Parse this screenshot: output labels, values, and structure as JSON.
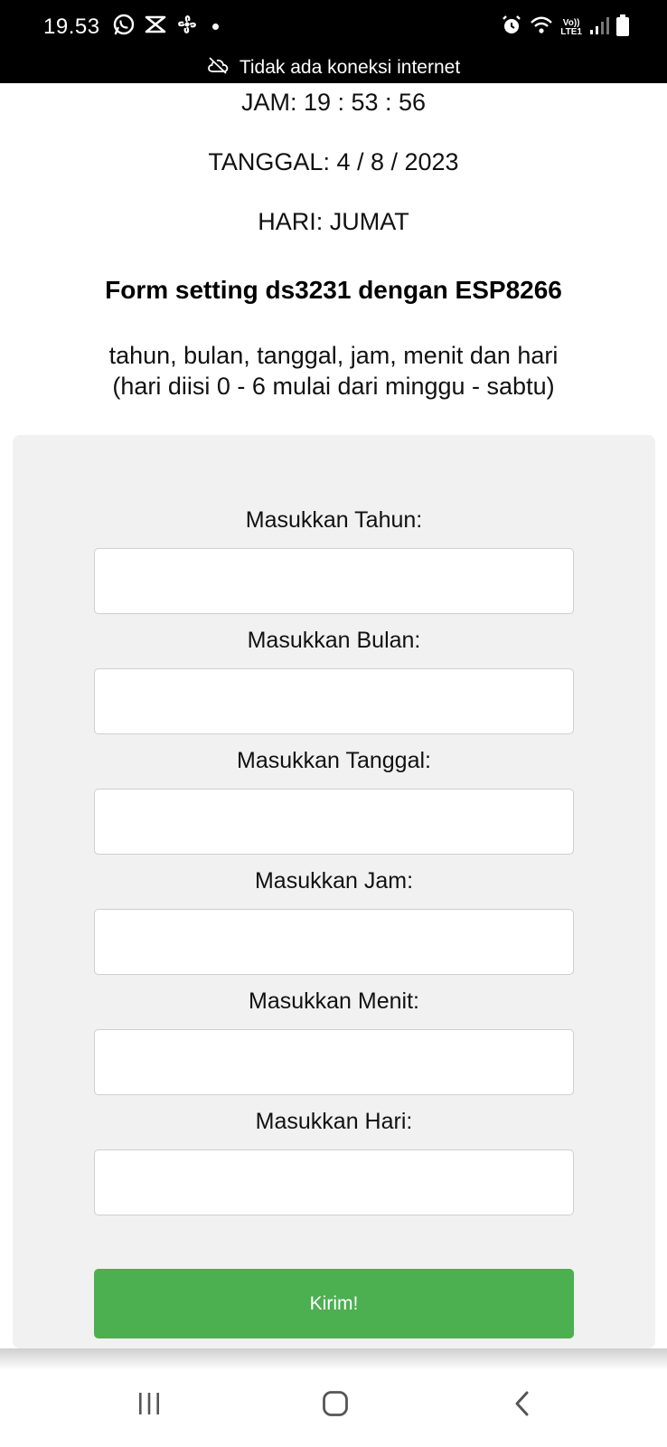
{
  "status_bar": {
    "time": "19.53",
    "left_icons": [
      "whatsapp-icon",
      "capcut-icon",
      "fan-icon",
      "dot-icon"
    ],
    "right_icons": [
      "alarm-icon",
      "wifi-icon",
      "volte-icon",
      "signal-icon",
      "battery-icon"
    ],
    "volte_line1": "Vo))",
    "volte_line2": "LTE1",
    "connection_icon": "cloud-off-icon",
    "connection_text": "Tidak ada koneksi internet"
  },
  "info": {
    "jam": "JAM: 19 : 53 : 56",
    "tanggal": "TANGGAL: 4 / 8 / 2023",
    "hari": "HARI: JUMAT"
  },
  "form": {
    "title": "Form setting ds3231 dengan ESP8266",
    "subtitle_line1": "tahun, bulan, tanggal, jam, menit dan hari",
    "subtitle_line2": "(hari diisi 0 - 6 mulai dari minggu - sabtu)",
    "fields": [
      {
        "label": "Masukkan Tahun:",
        "value": "",
        "placeholder": ""
      },
      {
        "label": "Masukkan Bulan:",
        "value": "",
        "placeholder": ""
      },
      {
        "label": "Masukkan Tanggal:",
        "value": "",
        "placeholder": ""
      },
      {
        "label": "Masukkan Jam:",
        "value": "",
        "placeholder": ""
      },
      {
        "label": "Masukkan Menit:",
        "value": "",
        "placeholder": ""
      },
      {
        "label": "Masukkan Hari:",
        "value": "",
        "placeholder": ""
      }
    ],
    "submit_label": "Kirim!"
  },
  "nav": {
    "icons": [
      "recent-apps-icon",
      "home-icon",
      "back-icon"
    ]
  },
  "colors": {
    "status_bar_bg": "#000000",
    "panel_bg": "#f1f1f1",
    "submit_bg": "#4caf50",
    "submit_text": "#ffffff"
  }
}
